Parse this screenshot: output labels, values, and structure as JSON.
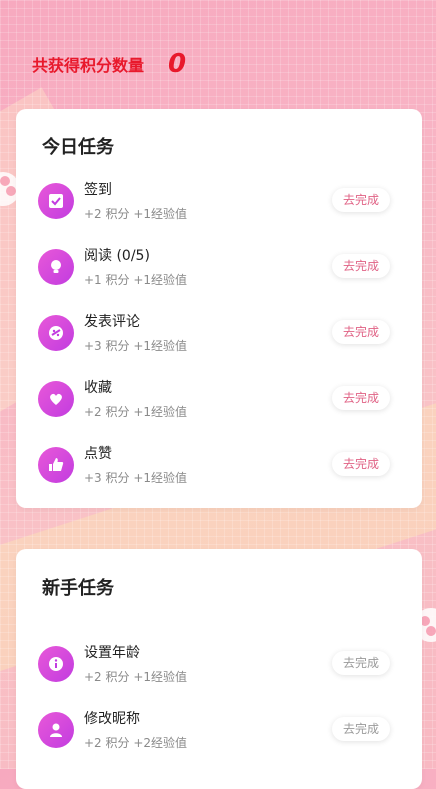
{
  "header": {
    "label": "共获得积分数量",
    "points": "0"
  },
  "daily": {
    "title": "今日任务",
    "tasks": [
      {
        "name": "签到",
        "reward": "+2 积分 +1经验值",
        "button": "去完成",
        "icon": "checkbox-icon"
      },
      {
        "name": "阅读 (0/5)",
        "reward": "+1 积分 +1经验值",
        "button": "去完成",
        "icon": "bulb-icon"
      },
      {
        "name": "发表评论",
        "reward": "+3 积分 +1经验值",
        "button": "去完成",
        "icon": "comment-icon"
      },
      {
        "name": "收藏",
        "reward": "+2 积分 +1经验值",
        "button": "去完成",
        "icon": "heart-icon"
      },
      {
        "name": "点赞",
        "reward": "+3 积分 +1经验值",
        "button": "去完成",
        "icon": "thumbs-up-icon"
      }
    ]
  },
  "newbie": {
    "title": "新手任务",
    "tasks": [
      {
        "name": "设置年龄",
        "reward": "+2 积分 +1经验值",
        "button": "去完成",
        "icon": "info-icon"
      },
      {
        "name": "修改昵称",
        "reward": "+2 积分 +2经验值",
        "button": "去完成",
        "icon": "user-icon"
      }
    ]
  },
  "colors": {
    "accent": "#e8192c",
    "icon_gradient_start": "#e858d8",
    "icon_gradient_end": "#c23ce0",
    "button_text_pink": "#e06285"
  }
}
